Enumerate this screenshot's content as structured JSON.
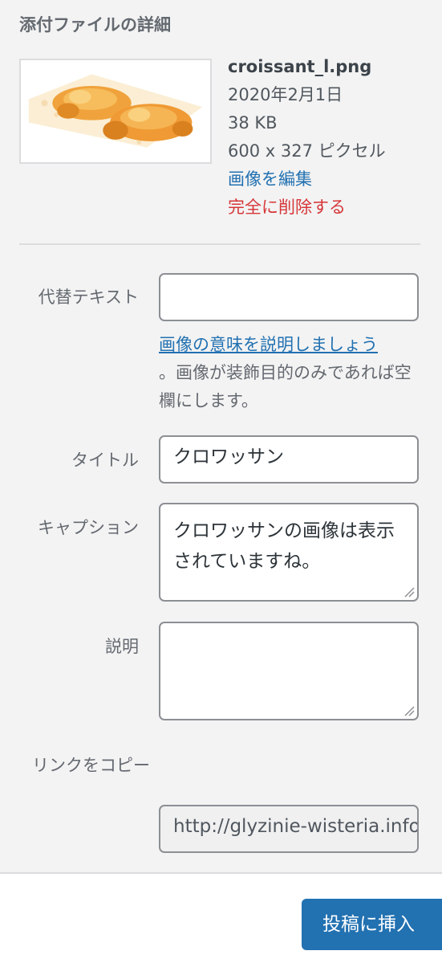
{
  "panel": {
    "title": "添付ファイルの詳細"
  },
  "file": {
    "name": "croissant_l.png",
    "date": "2020年2月1日",
    "size": "38 KB",
    "dimensions": "600 x 327 ピクセル",
    "edit_label": "画像を編集",
    "delete_label": "完全に削除する"
  },
  "fields": {
    "alt": {
      "label": "代替テキスト",
      "value": "",
      "help_link": "画像の意味を説明しましょう",
      "help_text": "。画像が装飾目的のみであれば空欄にします。"
    },
    "title": {
      "label": "タイトル",
      "value": "クロワッサン"
    },
    "caption": {
      "label": "キャプション",
      "value": "クロワッサンの画像は表示されていますね。"
    },
    "description": {
      "label": "説明",
      "value": ""
    },
    "link": {
      "label": "リンクをコピー",
      "value": "http://glyzinie-wisteria.info"
    }
  },
  "footer": {
    "insert_label": "投稿に挿入"
  },
  "colors": {
    "link": "#2271b1",
    "danger": "#d63638",
    "primary": "#2271b1"
  }
}
